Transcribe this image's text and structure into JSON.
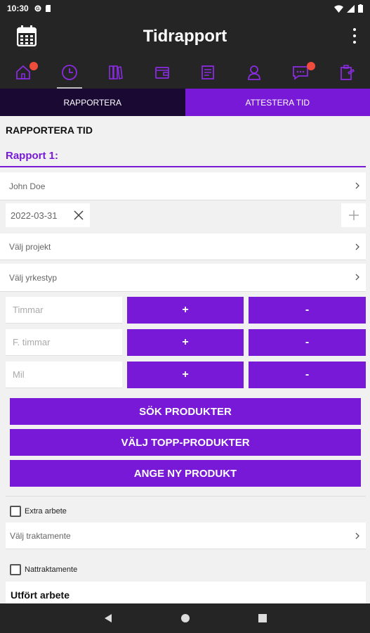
{
  "status_bar": {
    "time": "10:30",
    "icons": [
      "g-icon",
      "sd-card-icon",
      "wifi-icon",
      "signal-icon",
      "battery-icon"
    ]
  },
  "app_bar": {
    "title": "Tidrapport",
    "left_icon": "calendar-icon",
    "right_icon": "more-vert-icon"
  },
  "nav_icons": [
    {
      "name": "home-icon",
      "badge": true
    },
    {
      "name": "clock-icon",
      "active": true
    },
    {
      "name": "binders-icon"
    },
    {
      "name": "wallet-icon"
    },
    {
      "name": "document-icon"
    },
    {
      "name": "person-icon"
    },
    {
      "name": "chat-icon",
      "badge": true
    },
    {
      "name": "clipboard-icon"
    }
  ],
  "tabs": {
    "rapportera": "RAPPORTERA",
    "attestera": "ATTESTERA TID"
  },
  "form": {
    "section_title": "RAPPORTERA TID",
    "report_title": "Rapport 1:",
    "employee": "John Doe",
    "date": "2022-03-31",
    "project_placeholder": "Välj projekt",
    "profession_placeholder": "Välj yrkestyp",
    "hours_placeholder": "Timmar",
    "f_hours_placeholder": "F. timmar",
    "mil_placeholder": "Mil",
    "plus_label": "+",
    "minus_label": "-",
    "search_products": "SÖK PRODUKTER",
    "top_products": "VÄLJ TOPP-PRODUKTER",
    "new_product": "ANGE NY PRODUKT",
    "extra_work": "Extra arbete",
    "allowance_placeholder": "Välj traktamente",
    "night_allowance": "Nattraktamente",
    "work_done": "Utfört arbete"
  },
  "colors": {
    "accent": "#7719d6",
    "dark": "#252525",
    "tab_dark": "#1a0933",
    "badge": "#ef4c3c"
  }
}
